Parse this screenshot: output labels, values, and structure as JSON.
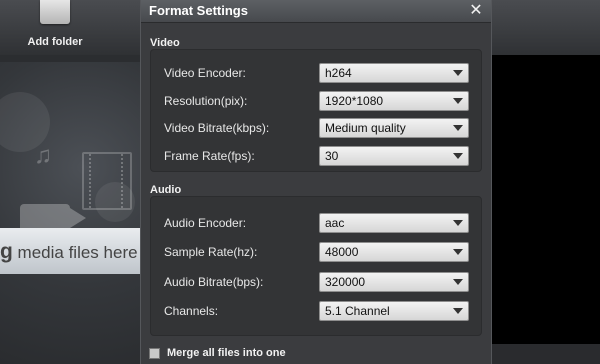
{
  "toolbar": {
    "add_folder_label": "Add folder"
  },
  "drop_area": {
    "text_bold": "g",
    "text": " media files here"
  },
  "dialog": {
    "title": "Format Settings",
    "close_glyph": "✕",
    "video": {
      "section_label": "Video",
      "rows": [
        {
          "label": "Video Encoder:",
          "value": "h264"
        },
        {
          "label": "Resolution(pix):",
          "value": "1920*1080"
        },
        {
          "label": "Video Bitrate(kbps):",
          "value": "Medium quality"
        },
        {
          "label": "Frame Rate(fps):",
          "value": "30"
        }
      ]
    },
    "audio": {
      "section_label": "Audio",
      "rows": [
        {
          "label": "Audio Encoder:",
          "value": "aac"
        },
        {
          "label": "Sample Rate(hz):",
          "value": "48000"
        },
        {
          "label": "Audio Bitrate(bps):",
          "value": "320000"
        },
        {
          "label": "Channels:",
          "value": "5.1 Channel"
        }
      ]
    },
    "merge": {
      "label": "Merge all files into one",
      "checked": false
    }
  },
  "colors": {
    "dialog_bg": "#3b3c3f",
    "panel_bg": "#333436",
    "titlebar": "#4f5256"
  }
}
